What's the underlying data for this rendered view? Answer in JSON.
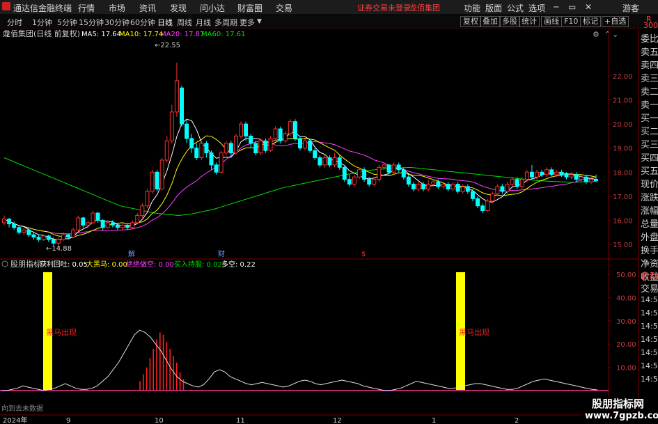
{
  "menubar": {
    "app_title": "通达信金融终端",
    "items": [
      "行情",
      "市场",
      "资讯",
      "发现",
      "问小达",
      "财富圈",
      "交易"
    ],
    "login_status": "证券交易未登录",
    "stock_name": "龙佰集团",
    "right_items": [
      "功能",
      "版面",
      "公式",
      "选项"
    ],
    "guest": "游客"
  },
  "toolbar": {
    "periods": [
      "分时",
      "1分钟",
      "5分钟",
      "15分钟",
      "30分钟",
      "60分钟",
      "日线",
      "周线",
      "月线",
      "多周期",
      "更多"
    ],
    "active_period": "日线",
    "right_buttons": [
      "复权",
      "叠加",
      "多股",
      "统计",
      "画线",
      "F10",
      "标记",
      "+自选"
    ]
  },
  "main_chart": {
    "title": "龙佰集团(日线 前复权)",
    "ma_labels": [
      {
        "text": "MA5: 17.64",
        "color": "#ffffff"
      },
      {
        "text": "MA10: 17.74",
        "color": "#ffff00"
      },
      {
        "text": "MA20: 17.87",
        "color": "#ff40ff"
      },
      {
        "text": "MA60: 17.61",
        "color": "#00e000"
      }
    ],
    "high_label": "22.55",
    "low_label": "14.88",
    "y_ticks": [
      "22.00",
      "21.00",
      "20.00",
      "19.00",
      "18.00",
      "17.00",
      "16.00",
      "15.00"
    ],
    "event_markers": [
      {
        "text": "解",
        "color": "#5fa0ff"
      },
      {
        "text": "财",
        "color": "#5fa0ff"
      },
      {
        "text": "$",
        "color": "#ff3030"
      }
    ]
  },
  "indicator": {
    "name": "股朋指标",
    "values": [
      {
        "text": "获利回吐: 0.05",
        "color": "#ffffff"
      },
      {
        "text": "大黑马: 0.00",
        "color": "#ffff00"
      },
      {
        "text": "绝绝做空: 0.00",
        "color": "#ff40ff"
      },
      {
        "text": "买入持股: 0.02",
        "color": "#00e000"
      },
      {
        "text": "多空: 0.22",
        "color": "#ffffff"
      }
    ],
    "signal_labels": [
      "黑马出现",
      "黑马出现"
    ],
    "y_ticks": [
      "50.00",
      "40.00",
      "30.00",
      "20.00",
      "10.00"
    ],
    "no_data_text": "向到去未数据"
  },
  "date_axis": {
    "labels": [
      "2024年",
      "9",
      "10",
      "11",
      "12",
      "1",
      "2"
    ]
  },
  "right_panel": {
    "header_top": "R",
    "header_num": "300",
    "items": [
      "委比",
      "卖五",
      "卖四",
      "卖三",
      "卖二",
      "卖一",
      "买一",
      "买二",
      "买三",
      "买四",
      "买五",
      "现价",
      "涨跌",
      "涨幅",
      "总量",
      "外盘",
      "换手",
      "净资",
      "收益"
    ],
    "lower_items": [
      "自动",
      "交易",
      "14:56",
      "14:56",
      "14:56",
      "14:56",
      "14:56",
      "14:56",
      "14:56"
    ]
  },
  "watermark": {
    "line1": "股朋指标网",
    "line2": "www.7gpzb.com"
  },
  "colors": {
    "up": "#ff3030",
    "down": "#00ffff",
    "ma5": "#ffffff",
    "ma10": "#ffff00",
    "ma20": "#ff40ff",
    "ma60": "#00e000",
    "grid": "#7a0000",
    "signal_bar": "#ffff00"
  },
  "candles": [
    [
      15.9,
      16.05,
      16.2,
      15.8
    ],
    [
      16.05,
      15.85,
      16.1,
      15.7
    ],
    [
      15.85,
      15.7,
      15.95,
      15.6
    ],
    [
      15.7,
      15.5,
      15.8,
      15.4
    ],
    [
      15.5,
      15.6,
      15.7,
      15.4
    ],
    [
      15.6,
      15.4,
      15.65,
      15.3
    ],
    [
      15.4,
      15.3,
      15.5,
      15.2
    ],
    [
      15.3,
      15.2,
      15.4,
      15.1
    ],
    [
      15.2,
      15.35,
      15.4,
      15.15
    ],
    [
      15.35,
      15.2,
      15.4,
      15.1
    ],
    [
      15.2,
      15.05,
      15.3,
      14.95
    ],
    [
      15.05,
      15.2,
      15.3,
      14.88
    ],
    [
      15.2,
      15.4,
      15.5,
      15.15
    ],
    [
      15.4,
      15.3,
      15.45,
      15.2
    ],
    [
      15.3,
      15.6,
      15.7,
      15.25
    ],
    [
      15.6,
      16.1,
      16.2,
      15.55
    ],
    [
      16.1,
      15.8,
      16.15,
      15.7
    ],
    [
      15.8,
      15.9,
      16.0,
      15.7
    ],
    [
      15.9,
      16.3,
      16.4,
      15.85
    ],
    [
      16.3,
      16.0,
      16.35,
      15.9
    ],
    [
      16.0,
      15.7,
      16.05,
      15.6
    ],
    [
      15.7,
      15.9,
      16.0,
      15.65
    ],
    [
      15.9,
      15.8,
      16.0,
      15.7
    ],
    [
      15.8,
      15.7,
      15.9,
      15.6
    ],
    [
      15.7,
      15.8,
      15.9,
      15.6
    ],
    [
      15.8,
      15.7,
      15.85,
      15.6
    ],
    [
      15.7,
      15.9,
      16.0,
      15.65
    ],
    [
      15.9,
      16.2,
      16.3,
      15.85
    ],
    [
      16.2,
      16.6,
      16.7,
      16.1
    ],
    [
      16.6,
      17.2,
      17.3,
      16.5
    ],
    [
      17.2,
      18.0,
      18.1,
      17.1
    ],
    [
      18.0,
      17.3,
      18.1,
      17.2
    ],
    [
      17.3,
      18.5,
      18.6,
      17.25
    ],
    [
      18.5,
      19.3,
      19.5,
      18.4
    ],
    [
      19.3,
      20.5,
      20.8,
      19.2
    ],
    [
      20.5,
      21.8,
      22.55,
      20.3
    ],
    [
      21.5,
      20.0,
      21.6,
      19.9
    ],
    [
      20.0,
      19.4,
      20.2,
      19.2
    ],
    [
      19.4,
      19.0,
      19.6,
      18.8
    ],
    [
      19.0,
      18.6,
      19.2,
      18.5
    ],
    [
      18.6,
      19.2,
      19.3,
      18.5
    ],
    [
      19.2,
      18.8,
      19.3,
      18.6
    ],
    [
      18.8,
      18.3,
      18.9,
      18.1
    ],
    [
      18.3,
      18.0,
      18.4,
      17.9
    ],
    [
      18.0,
      18.8,
      18.9,
      17.95
    ],
    [
      18.8,
      19.2,
      19.3,
      18.7
    ],
    [
      19.2,
      18.8,
      19.3,
      18.6
    ],
    [
      18.8,
      19.5,
      19.6,
      18.7
    ],
    [
      19.5,
      20.0,
      20.1,
      19.4
    ],
    [
      20.0,
      19.5,
      20.1,
      19.3
    ],
    [
      19.5,
      19.2,
      19.6,
      19.0
    ],
    [
      19.2,
      18.8,
      19.3,
      18.7
    ],
    [
      18.8,
      19.3,
      19.4,
      18.7
    ],
    [
      19.3,
      18.9,
      19.4,
      18.8
    ],
    [
      18.9,
      19.4,
      19.5,
      18.85
    ],
    [
      19.4,
      19.8,
      19.9,
      19.3
    ],
    [
      19.8,
      19.3,
      19.9,
      19.2
    ],
    [
      19.3,
      19.6,
      19.7,
      19.2
    ],
    [
      19.6,
      20.1,
      20.2,
      19.5
    ],
    [
      20.1,
      19.4,
      20.2,
      19.3
    ],
    [
      19.4,
      19.0,
      19.5,
      18.9
    ],
    [
      19.0,
      19.3,
      19.4,
      18.9
    ],
    [
      19.3,
      18.9,
      19.4,
      18.8
    ],
    [
      18.9,
      18.6,
      19.0,
      18.5
    ],
    [
      18.6,
      18.3,
      18.7,
      18.2
    ],
    [
      18.3,
      18.6,
      18.7,
      18.2
    ],
    [
      18.6,
      18.3,
      18.7,
      18.2
    ],
    [
      18.3,
      18.6,
      18.8,
      18.2
    ],
    [
      18.6,
      18.2,
      18.7,
      18.1
    ],
    [
      18.2,
      17.7,
      18.3,
      17.6
    ],
    [
      17.7,
      17.5,
      17.9,
      17.4
    ],
    [
      17.5,
      17.8,
      17.9,
      17.4
    ],
    [
      17.8,
      18.1,
      18.2,
      17.7
    ],
    [
      18.1,
      17.7,
      18.2,
      17.6
    ],
    [
      17.7,
      17.5,
      17.8,
      17.4
    ],
    [
      17.5,
      17.7,
      17.8,
      17.4
    ],
    [
      17.7,
      18.2,
      18.3,
      17.6
    ],
    [
      18.2,
      18.3,
      18.4,
      18.1
    ],
    [
      18.3,
      18.0,
      18.35,
      17.9
    ],
    [
      18.0,
      18.3,
      18.4,
      17.9
    ],
    [
      18.3,
      18.1,
      18.4,
      18.0
    ],
    [
      18.1,
      17.8,
      18.2,
      17.7
    ],
    [
      17.8,
      17.5,
      17.9,
      17.4
    ],
    [
      17.5,
      17.3,
      17.6,
      17.2
    ],
    [
      17.3,
      17.5,
      17.6,
      17.2
    ],
    [
      17.5,
      17.3,
      17.6,
      17.2
    ],
    [
      17.3,
      17.5,
      17.7,
      17.2
    ],
    [
      17.5,
      17.6,
      17.7,
      17.4
    ],
    [
      17.6,
      17.4,
      17.7,
      17.3
    ],
    [
      17.4,
      17.5,
      17.6,
      17.3
    ],
    [
      17.5,
      17.3,
      17.6,
      17.2
    ],
    [
      17.3,
      17.5,
      17.6,
      17.2
    ],
    [
      17.5,
      17.2,
      17.6,
      17.1
    ],
    [
      17.2,
      17.4,
      17.5,
      17.1
    ],
    [
      17.4,
      17.2,
      17.5,
      17.1
    ],
    [
      17.2,
      16.9,
      17.3,
      16.8
    ],
    [
      16.9,
      16.6,
      17.0,
      16.5
    ],
    [
      16.6,
      16.4,
      16.7,
      16.3
    ],
    [
      16.4,
      16.8,
      16.9,
      16.35
    ],
    [
      16.8,
      17.1,
      17.2,
      16.7
    ],
    [
      17.1,
      17.4,
      17.5,
      17.0
    ],
    [
      17.4,
      17.2,
      17.5,
      17.1
    ],
    [
      17.2,
      17.5,
      17.6,
      17.1
    ],
    [
      17.5,
      17.7,
      17.8,
      17.4
    ],
    [
      17.7,
      17.4,
      17.8,
      17.3
    ],
    [
      17.4,
      17.7,
      17.8,
      17.3
    ],
    [
      17.7,
      18.0,
      18.1,
      17.6
    ],
    [
      18.0,
      17.8,
      18.3,
      17.7
    ],
    [
      17.8,
      18.0,
      18.1,
      17.7
    ],
    [
      18.0,
      17.9,
      18.1,
      17.8
    ],
    [
      17.9,
      18.1,
      18.2,
      17.8
    ],
    [
      18.1,
      17.9,
      18.2,
      17.8
    ],
    [
      17.9,
      18.0,
      18.1,
      17.8
    ],
    [
      18.0,
      17.9,
      18.1,
      17.8
    ],
    [
      17.9,
      17.8,
      18.0,
      17.7
    ],
    [
      17.8,
      17.9,
      18.0,
      17.7
    ],
    [
      17.9,
      17.7,
      18.0,
      17.6
    ],
    [
      17.7,
      17.8,
      17.9,
      17.6
    ],
    [
      17.8,
      17.6,
      17.9,
      17.5
    ],
    [
      17.6,
      17.7,
      17.8,
      17.5
    ],
    [
      17.7,
      17.64,
      17.9,
      17.6
    ]
  ],
  "ma60_points": [
    18.6,
    18.4,
    18.2,
    18.0,
    17.8,
    17.6,
    17.4,
    17.2,
    17.0,
    16.8,
    16.6,
    16.5,
    16.4,
    16.3,
    16.25,
    16.2,
    16.25,
    16.35,
    16.45,
    16.6,
    16.75,
    16.9,
    17.05,
    17.2,
    17.35,
    17.45,
    17.55,
    17.65,
    17.75,
    17.85,
    17.95,
    18.05,
    18.1,
    18.15,
    18.18,
    18.2,
    18.15,
    18.1,
    18.05,
    18.0,
    17.95,
    17.9,
    17.85,
    17.8,
    17.75,
    17.7,
    17.65,
    17.62,
    17.6,
    17.58,
    17.6,
    17.61
  ],
  "oscillator": [
    0,
    0,
    0.5,
    1,
    2,
    1.5,
    1,
    0.5,
    0,
    0.5,
    1,
    2,
    3,
    2,
    1,
    0.5,
    0.5,
    1,
    2,
    4,
    6,
    9,
    12,
    16,
    20,
    24,
    26,
    25,
    23,
    20,
    17,
    13,
    9,
    6,
    4,
    3,
    2,
    1.5,
    2.5,
    5,
    8,
    9,
    8,
    6,
    5,
    4,
    3,
    2.5,
    3,
    3.5,
    3,
    2.5,
    2,
    1.5,
    2,
    3,
    4,
    4.5,
    4,
    3,
    2.5,
    3,
    3.5,
    4,
    4.5,
    4,
    3.5,
    3,
    2,
    1.5,
    1,
    0.5,
    0,
    0,
    0.5,
    1,
    2,
    3,
    4,
    3.5,
    3,
    2.5,
    2,
    1.5,
    1,
    1,
    1.5,
    2,
    2.5,
    3,
    3,
    2.5,
    2,
    1.5,
    1,
    0.5,
    0.5,
    1,
    2,
    3,
    4,
    4.5,
    5,
    4.5,
    4,
    3.5,
    3,
    2.5,
    2,
    1.5,
    1,
    0.5,
    0.3
  ],
  "red_bar_heights": [
    4,
    7,
    10,
    14,
    18,
    22,
    25,
    24,
    21,
    18,
    15,
    12,
    8,
    5
  ]
}
